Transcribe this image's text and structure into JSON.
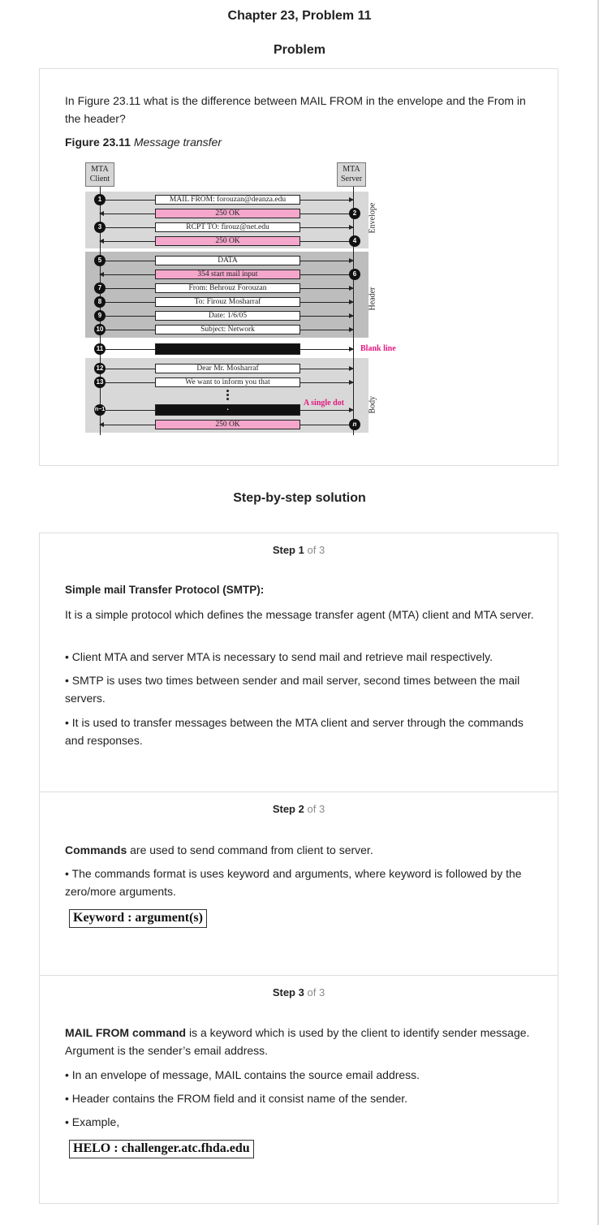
{
  "header": {
    "chapter_title": "Chapter 23, Problem 11",
    "problem_heading": "Problem",
    "solution_heading": "Step-by-step solution"
  },
  "problem": {
    "question": "In Figure 23.11 what is the difference between MAIL FROM in the envelope and the From in the header?",
    "figure_label": "Figure 23.11",
    "figure_caption": "Message transfer"
  },
  "figure": {
    "client_label": "MTA Client",
    "server_label": "MTA Server",
    "sections": [
      "Envelope",
      "Header",
      "Body"
    ],
    "messages": [
      {
        "num": "1",
        "text": "MAIL FROM: forouzan@deanza.edu"
      },
      {
        "num": "2",
        "text": "250 OK"
      },
      {
        "num": "3",
        "text": "RCPT TO: firouz@net.edu"
      },
      {
        "num": "4",
        "text": "250 OK"
      },
      {
        "num": "5",
        "text": "DATA"
      },
      {
        "num": "6",
        "text": "354 start mail input"
      },
      {
        "num": "7",
        "text": "From: Behrouz Forouzan"
      },
      {
        "num": "8",
        "text": "To: Firouz Mosharraf"
      },
      {
        "num": "9",
        "text": "Date: 1/6/05"
      },
      {
        "num": "10",
        "text": "Subject: Network"
      },
      {
        "num": "11",
        "text": ""
      },
      {
        "num": "12",
        "text": "Dear Mr. Mosharraf"
      },
      {
        "num": "13",
        "text": "We want to inform you that"
      },
      {
        "num": "n−1",
        "text": "."
      },
      {
        "num": "n",
        "text": "250 OK"
      }
    ],
    "blank_line_label": "Blank line",
    "single_dot_label": "A single dot"
  },
  "steps": [
    {
      "label": "Step",
      "number": "1",
      "of_total": "of 3",
      "heading": "Simple mail Transfer Protocol (SMTP):",
      "paragraphs": [
        "It is a simple protocol which defines the message transfer agent (MTA) client and MTA server.",
        "• Client MTA and server MTA is necessary to send mail and retrieve mail respectively.",
        "• SMTP is uses two times between sender and mail server, second times between the mail servers.",
        "• It is used to transfer messages between the MTA client and server through the commands and responses."
      ]
    },
    {
      "label": "Step",
      "number": "2",
      "of_total": "of 3",
      "lead_bold": "Commands",
      "lead_rest": " are used to send command from client to server.",
      "paragraphs": [
        "• The commands format is uses keyword and arguments, where keyword is followed by the zero/more arguments."
      ],
      "formula": "Keyword :  argument(s)"
    },
    {
      "label": "Step",
      "number": "3",
      "of_total": "of 3",
      "lead_bold": "MAIL FROM command",
      "lead_rest": " is a keyword which is used by the client to identify sender message. Argument is the sender’s email address.",
      "paragraphs": [
        "• In an envelope of message, MAIL contains the source email address.",
        "• Header contains the FROM field and it consist name of the sender.",
        "• Example,"
      ],
      "formula": "HELO :  challenger.atc.fhda.edu"
    }
  ]
}
